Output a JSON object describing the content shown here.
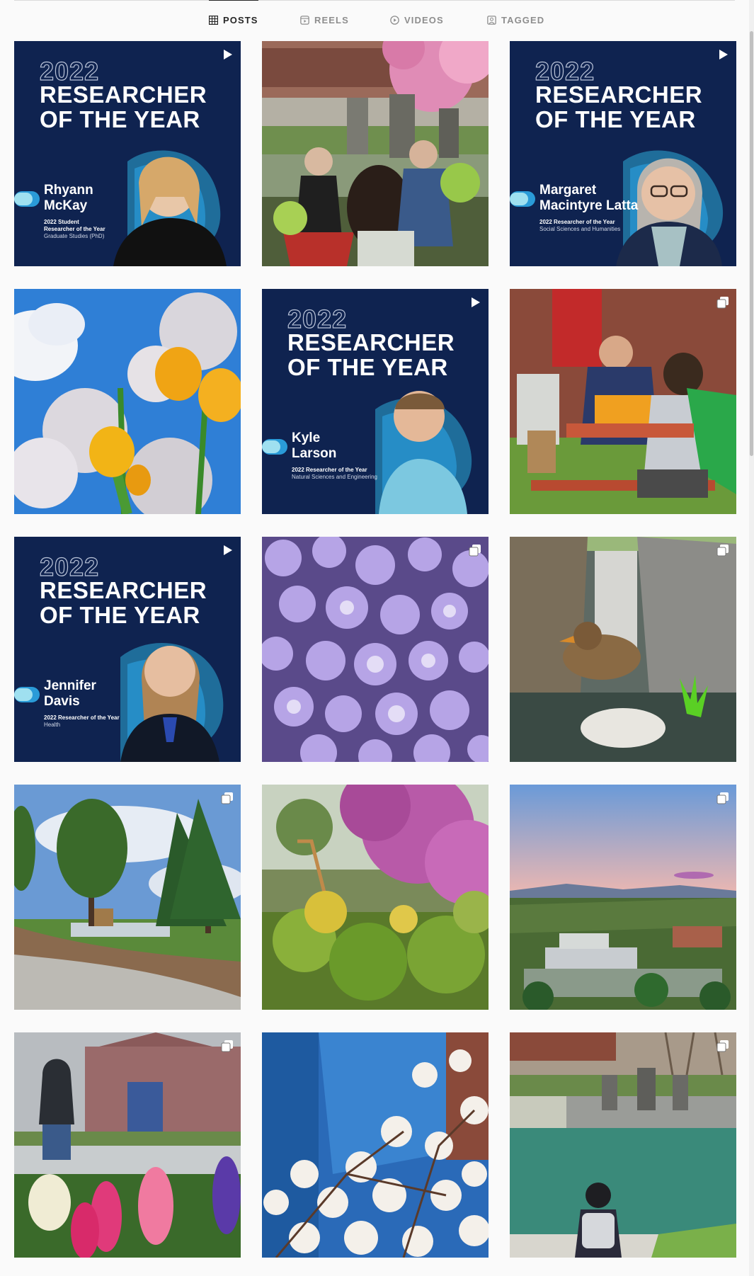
{
  "tabs": [
    {
      "label": "POSTS",
      "icon": "grid-icon",
      "active": true
    },
    {
      "label": "REELS",
      "icon": "reels-icon",
      "active": false
    },
    {
      "label": "VIDEOS",
      "icon": "video-icon",
      "active": false
    },
    {
      "label": "TAGGED",
      "icon": "tagged-icon",
      "active": false
    }
  ],
  "colors": {
    "card_bg": "#0f2350",
    "card_accent": "#2a9bd8",
    "text_muted": "#8e8e8e"
  },
  "researcher_cards": [
    {
      "year": "2022",
      "title_line1": "RESEARCHER",
      "title_line2": "OF THE YEAR",
      "name_line1": "Rhyann",
      "name_line2": "McKay",
      "role_line1": "2022 Student",
      "role_line2": "Researcher of the Year",
      "subtitle": "Graduate Studies (PhD)"
    },
    {
      "year": "2022",
      "title_line1": "RESEARCHER",
      "title_line2": "OF THE YEAR",
      "name_line1": "Margaret",
      "name_line2": "Macintyre Latta",
      "role_line1": "2022 Researcher of the Year",
      "subtitle": "Social Sciences and Humanities"
    },
    {
      "year": "2022",
      "title_line1": "RESEARCHER",
      "title_line2": "OF THE YEAR",
      "name_line1": "Kyle",
      "name_line2": "Larson",
      "role_line1": "2022 Researcher of the Year",
      "subtitle": "Natural Sciences and Engineering"
    },
    {
      "year": "2022",
      "title_line1": "RESEARCHER",
      "title_line2": "OF THE YEAR",
      "name_line1": "Jennifer",
      "name_line2": "Davis",
      "role_line1": "2022 Researcher of the Year",
      "subtitle": "Health"
    }
  ],
  "posts": [
    {
      "kind": "reel-card",
      "badge": "reel-icon"
    },
    {
      "kind": "photo",
      "subject": "students-outdoors-blossoms"
    },
    {
      "kind": "reel-card",
      "badge": "reel-icon"
    },
    {
      "kind": "photo",
      "subject": "tulips-blossoms-sky"
    },
    {
      "kind": "reel-card",
      "badge": "reel-icon"
    },
    {
      "kind": "carousel",
      "subject": "picnic-table-people",
      "badge": "carousel-icon"
    },
    {
      "kind": "reel-card",
      "badge": "reel-icon"
    },
    {
      "kind": "carousel",
      "subject": "purple-phlox",
      "badge": "carousel-icon"
    },
    {
      "kind": "carousel",
      "subject": "duck-in-fountain",
      "badge": "carousel-icon"
    },
    {
      "kind": "carousel",
      "subject": "pine-trees-path",
      "badge": "carousel-icon"
    },
    {
      "kind": "photo",
      "subject": "blossom-garden"
    },
    {
      "kind": "carousel",
      "subject": "campus-aerial-sunset",
      "badge": "carousel-icon"
    },
    {
      "kind": "carousel",
      "subject": "hyacinths-walker",
      "badge": "carousel-icon"
    },
    {
      "kind": "photo",
      "subject": "magnolia-building"
    },
    {
      "kind": "carousel",
      "subject": "fountain-student",
      "badge": "carousel-icon"
    }
  ]
}
